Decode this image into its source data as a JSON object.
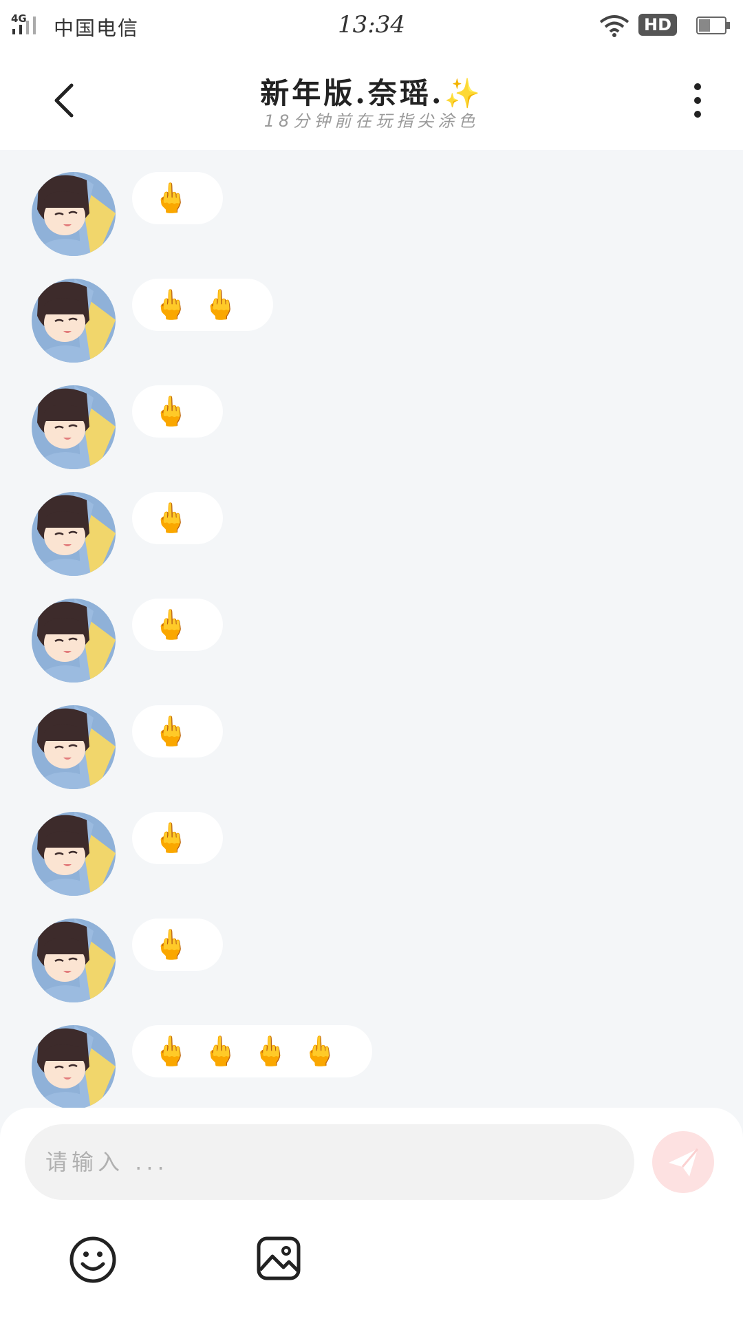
{
  "status_bar": {
    "network": "4G",
    "carrier": "中国电信",
    "time": "13:34",
    "hd_label": "HD"
  },
  "header": {
    "title": "新年版.奈瑶.",
    "title_icon": "sparkles-emoji",
    "subtitle": "18分钟前在玩指尖涂色"
  },
  "messages": [
    {
      "text": "🖕"
    },
    {
      "text": "🖕🖕"
    },
    {
      "text": "🖕"
    },
    {
      "text": "🖕"
    },
    {
      "text": "🖕"
    },
    {
      "text": "🖕"
    },
    {
      "text": "🖕"
    },
    {
      "text": "🖕"
    },
    {
      "text": "🖕🖕🖕🖕"
    }
  ],
  "composer": {
    "placeholder": "请输入 ...",
    "send_icon": "paper-plane-icon",
    "emoji_icon": "smiley-icon",
    "image_icon": "image-icon"
  },
  "colors": {
    "chat_background": "#f4f6f8",
    "bubble": "#ffffff",
    "send_button": "#fde1e1",
    "subtitle": "#9a9a9a"
  }
}
